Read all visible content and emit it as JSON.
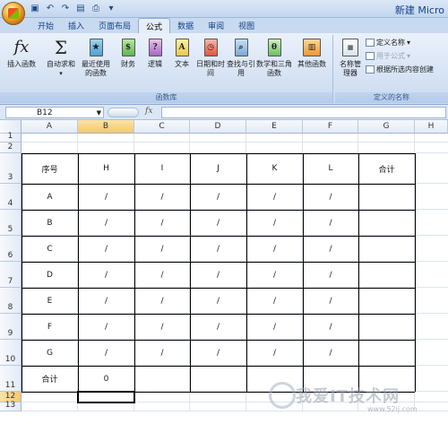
{
  "window": {
    "title": "新建 Micro"
  },
  "quick_access": [
    "save-icon",
    "undo-icon",
    "redo-icon",
    "print-preview-icon",
    "print-icon",
    "customize-icon"
  ],
  "tabs": [
    "开始",
    "插入",
    "页面布局",
    "公式",
    "数据",
    "审阅",
    "视图"
  ],
  "active_tab": "公式",
  "ribbon": {
    "group_library": {
      "label": "函数库",
      "insert_function": "插入函数",
      "autosum": "自动求和",
      "recent": "最近使用的函数",
      "financial": "财务",
      "logical": "逻辑",
      "text": "文本",
      "datetime": "日期和时间",
      "lookup": "查找与引用",
      "math": "数学和三角函数",
      "more": "其他函数"
    },
    "group_names": {
      "label": "定义的名称",
      "manager": "名称管理器",
      "define_name": "定义名称",
      "use_in_formula": "用于公式",
      "create_from_selection": "根据所选内容创建"
    }
  },
  "formula_bar": {
    "name_box": "B12",
    "fx": "fx",
    "formula": ""
  },
  "sheet": {
    "columns": [
      "A",
      "B",
      "C",
      "D",
      "E",
      "F",
      "G",
      "H"
    ],
    "rows": [
      "1",
      "2",
      "3",
      "4",
      "5",
      "6",
      "7",
      "8",
      "9",
      "10",
      "11",
      "12",
      "13"
    ],
    "table_header": [
      "序号",
      "H",
      "I",
      "J",
      "K",
      "L",
      "合计"
    ],
    "table_rows": [
      [
        "A",
        "/",
        "/",
        "/",
        "/",
        "/",
        ""
      ],
      [
        "B",
        "/",
        "/",
        "/",
        "/",
        "/",
        ""
      ],
      [
        "C",
        "/",
        "/",
        "/",
        "/",
        "/",
        ""
      ],
      [
        "D",
        "/",
        "/",
        "/",
        "/",
        "/",
        ""
      ],
      [
        "E",
        "/",
        "/",
        "/",
        "/",
        "/",
        ""
      ],
      [
        "F",
        "/",
        "/",
        "/",
        "/",
        "/",
        ""
      ],
      [
        "G",
        "/",
        "/",
        "/",
        "/",
        "/",
        ""
      ],
      [
        "合计",
        "0",
        "",
        "",
        "",
        "",
        ""
      ]
    ],
    "selected_cell": "B12"
  },
  "watermark": {
    "text": "我爱IT技术网",
    "url": "www.52ij.com"
  }
}
